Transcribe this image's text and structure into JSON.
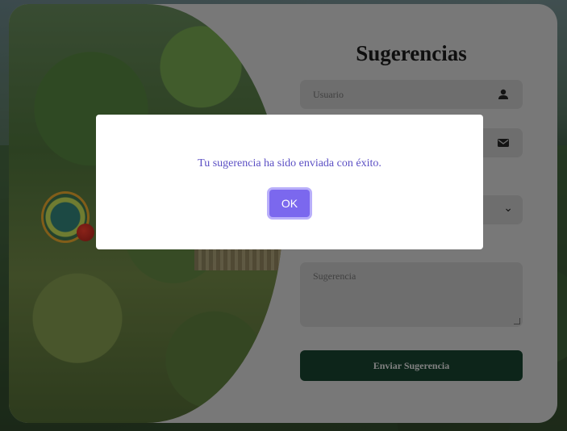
{
  "form": {
    "title": "Sugerencias",
    "user_placeholder": "Usuario",
    "user_icon": "user-icon",
    "email_placeholder": "",
    "email_icon": "envelope-icon",
    "select_icon": "chevron-down-icon",
    "suggestion_placeholder": "Sugerencia",
    "submit_label": "Enviar Sugerencia"
  },
  "modal": {
    "message": "Tu sugerencia ha sido enviada con éxito.",
    "ok_label": "OK"
  },
  "colors": {
    "submit_bg": "#163e2c",
    "ok_bg": "#7b68ee",
    "message_text": "#5b4fc4",
    "card_bg": "#c9c9c9"
  }
}
